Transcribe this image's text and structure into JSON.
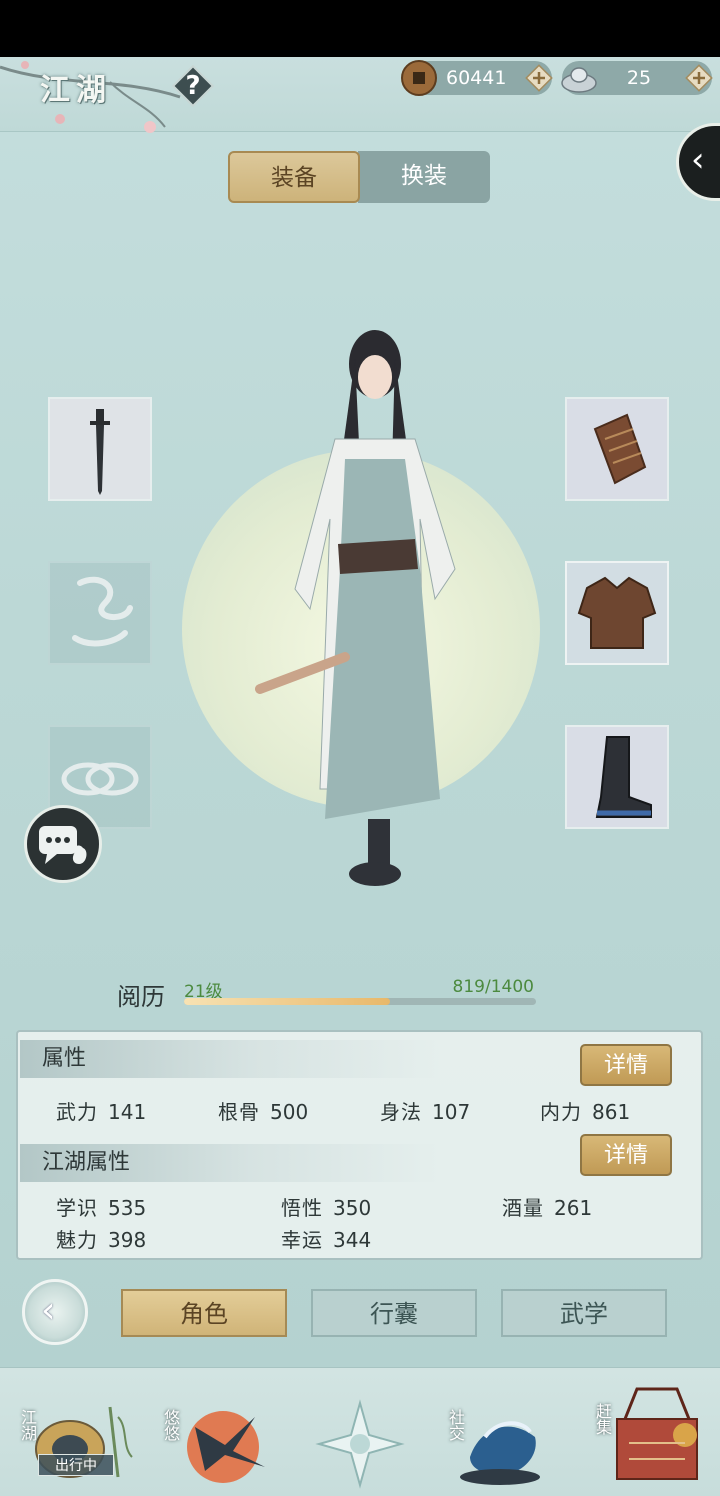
{
  "header": {
    "title": "江湖",
    "help_label": "?",
    "coins": "60441",
    "silver": "25"
  },
  "tabs": [
    {
      "label": "装备",
      "active": true
    },
    {
      "label": "换装",
      "active": false
    }
  ],
  "experience": {
    "label": "阅历",
    "level": "21级",
    "value_text": "819/1400",
    "current": 819,
    "max": 1400
  },
  "attributes": {
    "title": "属性",
    "detail_label": "详情",
    "items": [
      {
        "name": "武力",
        "value": "141"
      },
      {
        "name": "根骨",
        "value": "500"
      },
      {
        "name": "身法",
        "value": "107"
      },
      {
        "name": "内力",
        "value": "861"
      }
    ]
  },
  "jianghu_attributes": {
    "title": "江湖属性",
    "detail_label": "详情",
    "items": [
      {
        "name": "学识",
        "value": "535"
      },
      {
        "name": "悟性",
        "value": "350"
      },
      {
        "name": "酒量",
        "value": "261"
      },
      {
        "name": "魅力",
        "value": "398"
      },
      {
        "name": "幸运",
        "value": "344"
      }
    ]
  },
  "nav": {
    "role": "角色",
    "bag": "行囊",
    "skill": "武学"
  },
  "bottom_nav": {
    "jianghu": "江湖",
    "traveling": "出行中",
    "youyou": "悠悠",
    "social": "社交",
    "market": "赶集"
  },
  "colors": {
    "background": "#bcd8d6",
    "gold_button": "#c9ad73",
    "exp_fill": "#e8b86a",
    "exp_text": "#4c8a3f"
  }
}
